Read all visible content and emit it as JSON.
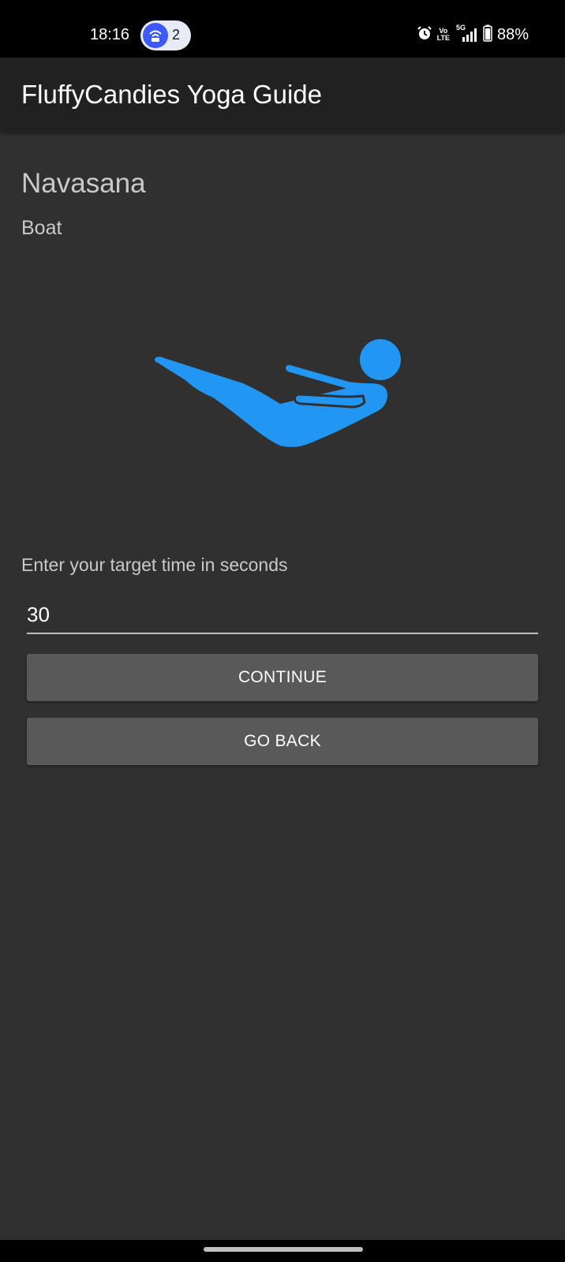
{
  "status_bar": {
    "time": "18:16",
    "hotspot_count": "2",
    "network_top": "Vo",
    "network_bottom": "LTE",
    "network_5g": "5G",
    "battery": "88%",
    "icons": [
      "hotspot-icon",
      "alarm-icon",
      "volte-icon",
      "signal-5g-icon",
      "battery-icon"
    ]
  },
  "app_bar": {
    "title": "FluffyCandies Yoga Guide"
  },
  "pose": {
    "sanskrit_name": "Navasana",
    "english_name": "Boat",
    "figure_icon": "boat-pose-icon",
    "figure_color": "#2196F3"
  },
  "form": {
    "label": "Enter your target time in seconds",
    "time_value": "30"
  },
  "buttons": {
    "continue_label": "CONTINUE",
    "back_label": "GO BACK"
  },
  "colors": {
    "background": "#303030",
    "app_bar": "#212121",
    "button": "#595959",
    "accent": "#2196F3"
  }
}
